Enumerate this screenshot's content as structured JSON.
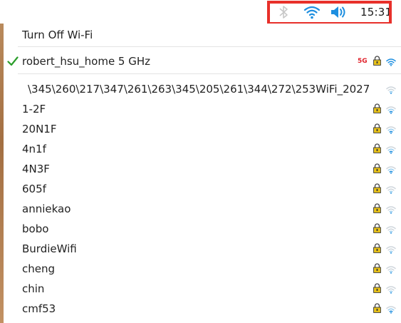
{
  "panel": {
    "clock": "15:31",
    "icons": [
      "bluetooth-icon",
      "wifi-icon",
      "volume-icon"
    ]
  },
  "menu": {
    "turn_off": "Turn Off Wi-Fi",
    "connected": {
      "ssid": "robert_hsu_home 5 GHz",
      "band_badge": "5G",
      "status_icon": "check-icon"
    },
    "networks": [
      {
        "ssid": "\\345\\260\\217\\347\\261\\263\\345\\205\\261\\344\\272\\253WiFi_2027",
        "secured": false
      },
      {
        "ssid": "1-2F",
        "secured": true
      },
      {
        "ssid": "20N1F",
        "secured": true
      },
      {
        "ssid": "4n1f",
        "secured": true
      },
      {
        "ssid": "4N3F",
        "secured": true
      },
      {
        "ssid": "605f",
        "secured": true
      },
      {
        "ssid": "anniekao",
        "secured": true
      },
      {
        "ssid": "bobo",
        "secured": true
      },
      {
        "ssid": "BurdieWifi",
        "secured": true
      },
      {
        "ssid": "cheng",
        "secured": true
      },
      {
        "ssid": "chin",
        "secured": true
      },
      {
        "ssid": "cmf53",
        "secured": true
      }
    ]
  },
  "colors": {
    "accent_blue": "#1e8fe0",
    "check_green": "#2a9d2a",
    "badge_red": "#e0202a",
    "highlight_red": "#e8302a",
    "lock_gold": "#e8c21a"
  }
}
